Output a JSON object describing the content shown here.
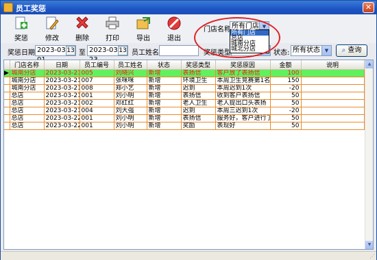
{
  "window": {
    "title": "员工奖惩",
    "close_glyph": "✕"
  },
  "toolbar": [
    {
      "label": "奖惩",
      "icon": "add-icon"
    },
    {
      "label": "修改",
      "icon": "edit-icon"
    },
    {
      "label": "删除",
      "icon": "delete-icon"
    },
    {
      "label": "打印",
      "icon": "printer-icon"
    },
    {
      "label": "导出",
      "icon": "export-icon"
    },
    {
      "label": "退出",
      "icon": "exit-icon"
    }
  ],
  "store_filter": {
    "label": "门店名称:",
    "selected": "所有门店",
    "options": [
      "所有门店",
      "总店",
      "城南分店",
      "城北分店"
    ]
  },
  "filters": {
    "date_label": "奖惩日期:",
    "date_from": "2023-03-01",
    "to_label": "至",
    "date_to": "2023-03-23",
    "calendar_glyph": "13",
    "name_label": "员工姓名:",
    "name_value": "",
    "type_label": "奖惩类型:",
    "type_value": "",
    "status_label": "状态:",
    "status_value": "所有状态",
    "query_label": "查询"
  },
  "grid": {
    "indicator": "▶",
    "columns": [
      "门店名称",
      "日期",
      "员工编号",
      "员工姓名",
      "状态",
      "奖惩类型",
      "奖惩原因",
      "金额",
      "说明"
    ],
    "rows": [
      [
        "城南分店",
        "2023-03-21",
        "005",
        "刘晓兴",
        "新增",
        "表扬信",
        "客户放了表扬信",
        "100",
        ""
      ],
      [
        "城南分店",
        "2023-03-21",
        "007",
        "张咪咪",
        "新增",
        "环境卫生",
        "本周卫生竞赛第1名",
        "150",
        ""
      ],
      [
        "城南分店",
        "2023-03-21",
        "008",
        "郑小艺",
        "新增",
        "迟到",
        "本周迟到1次",
        "-20",
        ""
      ],
      [
        "总店",
        "2023-03-21",
        "001",
        "刘小明",
        "新增",
        "表扬信",
        "收到客户表扬信",
        "50",
        ""
      ],
      [
        "总店",
        "2023-03-21",
        "002",
        "邓红红",
        "新增",
        "老人卫生",
        "老人提出口头表扬",
        "50",
        ""
      ],
      [
        "总店",
        "2023-03-21",
        "004",
        "刘大强",
        "新增",
        "迟到",
        "本周三迟到1次",
        "-20",
        ""
      ],
      [
        "总店",
        "2023-03-22",
        "001",
        "刘小明",
        "新增",
        "表扬信",
        "服务好，客户进行了表",
        "50",
        ""
      ],
      [
        "总店",
        "2023-03-22",
        "001",
        "刘小明",
        "新增",
        "奖励",
        "表现好",
        "50",
        ""
      ]
    ]
  },
  "colors": {
    "title_bar": "#1d56c4",
    "selected_row": "#63f05d",
    "selected_text": "#ee1b1b",
    "grid_line": "#ea8b29",
    "highlight_circle": "#e02222"
  }
}
